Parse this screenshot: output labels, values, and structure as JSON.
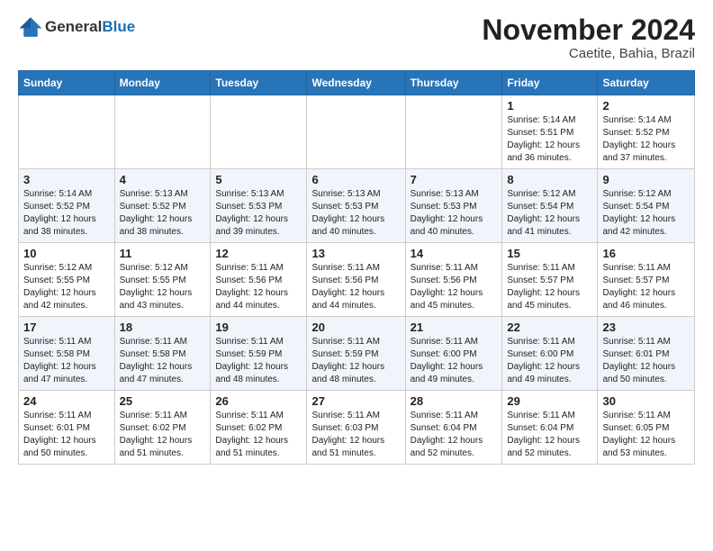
{
  "header": {
    "logo_general": "General",
    "logo_blue": "Blue",
    "month_title": "November 2024",
    "location": "Caetite, Bahia, Brazil"
  },
  "days_of_week": [
    "Sunday",
    "Monday",
    "Tuesday",
    "Wednesday",
    "Thursday",
    "Friday",
    "Saturday"
  ],
  "weeks": [
    [
      {
        "day": "",
        "info": ""
      },
      {
        "day": "",
        "info": ""
      },
      {
        "day": "",
        "info": ""
      },
      {
        "day": "",
        "info": ""
      },
      {
        "day": "",
        "info": ""
      },
      {
        "day": "1",
        "info": "Sunrise: 5:14 AM\nSunset: 5:51 PM\nDaylight: 12 hours\nand 36 minutes."
      },
      {
        "day": "2",
        "info": "Sunrise: 5:14 AM\nSunset: 5:52 PM\nDaylight: 12 hours\nand 37 minutes."
      }
    ],
    [
      {
        "day": "3",
        "info": "Sunrise: 5:14 AM\nSunset: 5:52 PM\nDaylight: 12 hours\nand 38 minutes."
      },
      {
        "day": "4",
        "info": "Sunrise: 5:13 AM\nSunset: 5:52 PM\nDaylight: 12 hours\nand 38 minutes."
      },
      {
        "day": "5",
        "info": "Sunrise: 5:13 AM\nSunset: 5:53 PM\nDaylight: 12 hours\nand 39 minutes."
      },
      {
        "day": "6",
        "info": "Sunrise: 5:13 AM\nSunset: 5:53 PM\nDaylight: 12 hours\nand 40 minutes."
      },
      {
        "day": "7",
        "info": "Sunrise: 5:13 AM\nSunset: 5:53 PM\nDaylight: 12 hours\nand 40 minutes."
      },
      {
        "day": "8",
        "info": "Sunrise: 5:12 AM\nSunset: 5:54 PM\nDaylight: 12 hours\nand 41 minutes."
      },
      {
        "day": "9",
        "info": "Sunrise: 5:12 AM\nSunset: 5:54 PM\nDaylight: 12 hours\nand 42 minutes."
      }
    ],
    [
      {
        "day": "10",
        "info": "Sunrise: 5:12 AM\nSunset: 5:55 PM\nDaylight: 12 hours\nand 42 minutes."
      },
      {
        "day": "11",
        "info": "Sunrise: 5:12 AM\nSunset: 5:55 PM\nDaylight: 12 hours\nand 43 minutes."
      },
      {
        "day": "12",
        "info": "Sunrise: 5:11 AM\nSunset: 5:56 PM\nDaylight: 12 hours\nand 44 minutes."
      },
      {
        "day": "13",
        "info": "Sunrise: 5:11 AM\nSunset: 5:56 PM\nDaylight: 12 hours\nand 44 minutes."
      },
      {
        "day": "14",
        "info": "Sunrise: 5:11 AM\nSunset: 5:56 PM\nDaylight: 12 hours\nand 45 minutes."
      },
      {
        "day": "15",
        "info": "Sunrise: 5:11 AM\nSunset: 5:57 PM\nDaylight: 12 hours\nand 45 minutes."
      },
      {
        "day": "16",
        "info": "Sunrise: 5:11 AM\nSunset: 5:57 PM\nDaylight: 12 hours\nand 46 minutes."
      }
    ],
    [
      {
        "day": "17",
        "info": "Sunrise: 5:11 AM\nSunset: 5:58 PM\nDaylight: 12 hours\nand 47 minutes."
      },
      {
        "day": "18",
        "info": "Sunrise: 5:11 AM\nSunset: 5:58 PM\nDaylight: 12 hours\nand 47 minutes."
      },
      {
        "day": "19",
        "info": "Sunrise: 5:11 AM\nSunset: 5:59 PM\nDaylight: 12 hours\nand 48 minutes."
      },
      {
        "day": "20",
        "info": "Sunrise: 5:11 AM\nSunset: 5:59 PM\nDaylight: 12 hours\nand 48 minutes."
      },
      {
        "day": "21",
        "info": "Sunrise: 5:11 AM\nSunset: 6:00 PM\nDaylight: 12 hours\nand 49 minutes."
      },
      {
        "day": "22",
        "info": "Sunrise: 5:11 AM\nSunset: 6:00 PM\nDaylight: 12 hours\nand 49 minutes."
      },
      {
        "day": "23",
        "info": "Sunrise: 5:11 AM\nSunset: 6:01 PM\nDaylight: 12 hours\nand 50 minutes."
      }
    ],
    [
      {
        "day": "24",
        "info": "Sunrise: 5:11 AM\nSunset: 6:01 PM\nDaylight: 12 hours\nand 50 minutes."
      },
      {
        "day": "25",
        "info": "Sunrise: 5:11 AM\nSunset: 6:02 PM\nDaylight: 12 hours\nand 51 minutes."
      },
      {
        "day": "26",
        "info": "Sunrise: 5:11 AM\nSunset: 6:02 PM\nDaylight: 12 hours\nand 51 minutes."
      },
      {
        "day": "27",
        "info": "Sunrise: 5:11 AM\nSunset: 6:03 PM\nDaylight: 12 hours\nand 51 minutes."
      },
      {
        "day": "28",
        "info": "Sunrise: 5:11 AM\nSunset: 6:04 PM\nDaylight: 12 hours\nand 52 minutes."
      },
      {
        "day": "29",
        "info": "Sunrise: 5:11 AM\nSunset: 6:04 PM\nDaylight: 12 hours\nand 52 minutes."
      },
      {
        "day": "30",
        "info": "Sunrise: 5:11 AM\nSunset: 6:05 PM\nDaylight: 12 hours\nand 53 minutes."
      }
    ]
  ]
}
